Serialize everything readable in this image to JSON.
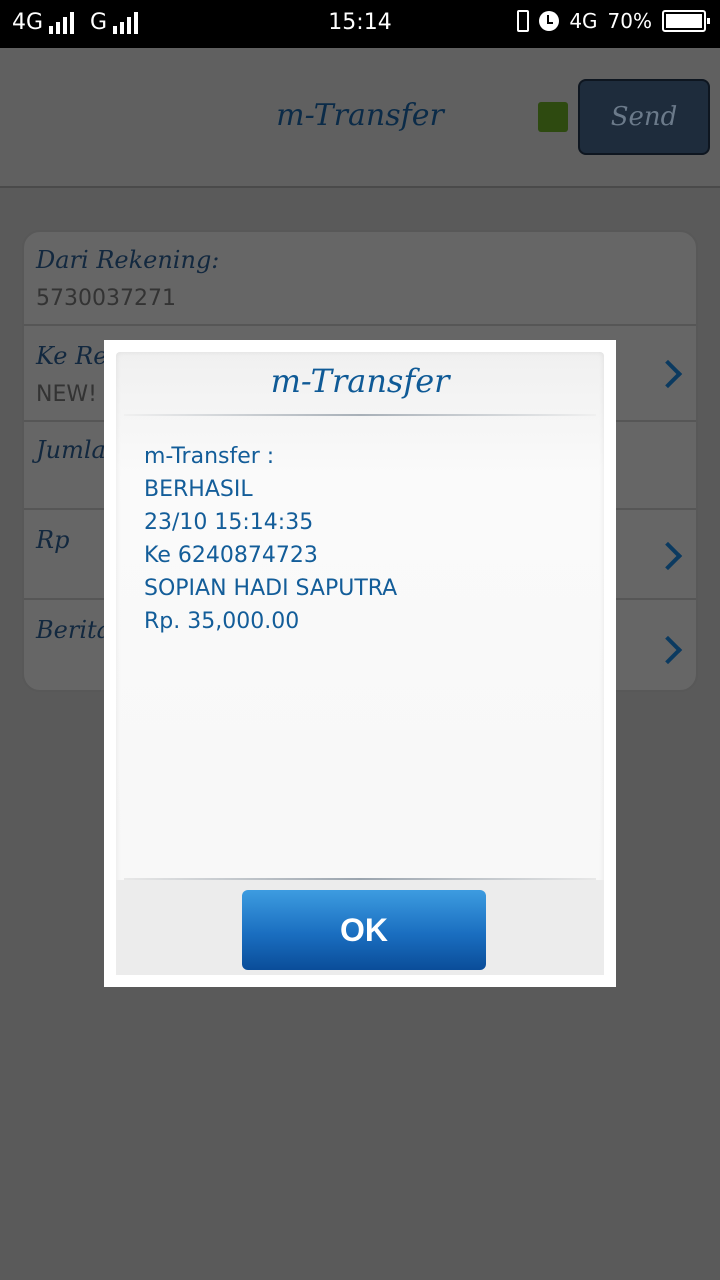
{
  "status_bar": {
    "network_left_1": "4G",
    "network_left_2": "G",
    "time": "15:14",
    "network_right": "4G",
    "battery": "70%"
  },
  "header": {
    "title": "m-Transfer",
    "send_label": "Send",
    "indicator_color": "#2e4a10"
  },
  "form": {
    "rows": [
      {
        "label": "Dari Rekening:",
        "value": "5730037271"
      },
      {
        "label": "Ke Reke",
        "value": "NEW! 6"
      },
      {
        "label": "Jumlah",
        "value": ""
      },
      {
        "label": "Rp",
        "value": ""
      },
      {
        "label": "Berita:",
        "value": ""
      }
    ]
  },
  "dialog": {
    "title": "m-Transfer",
    "lines": [
      "m-Transfer :",
      "BERHASIL",
      "23/10 15:14:35",
      "Ke 6240874723",
      "SOPIAN HADI SAPUTRA",
      "Rp. 35,000.00"
    ],
    "ok_label": "OK",
    "accent_color": "#135d99"
  }
}
